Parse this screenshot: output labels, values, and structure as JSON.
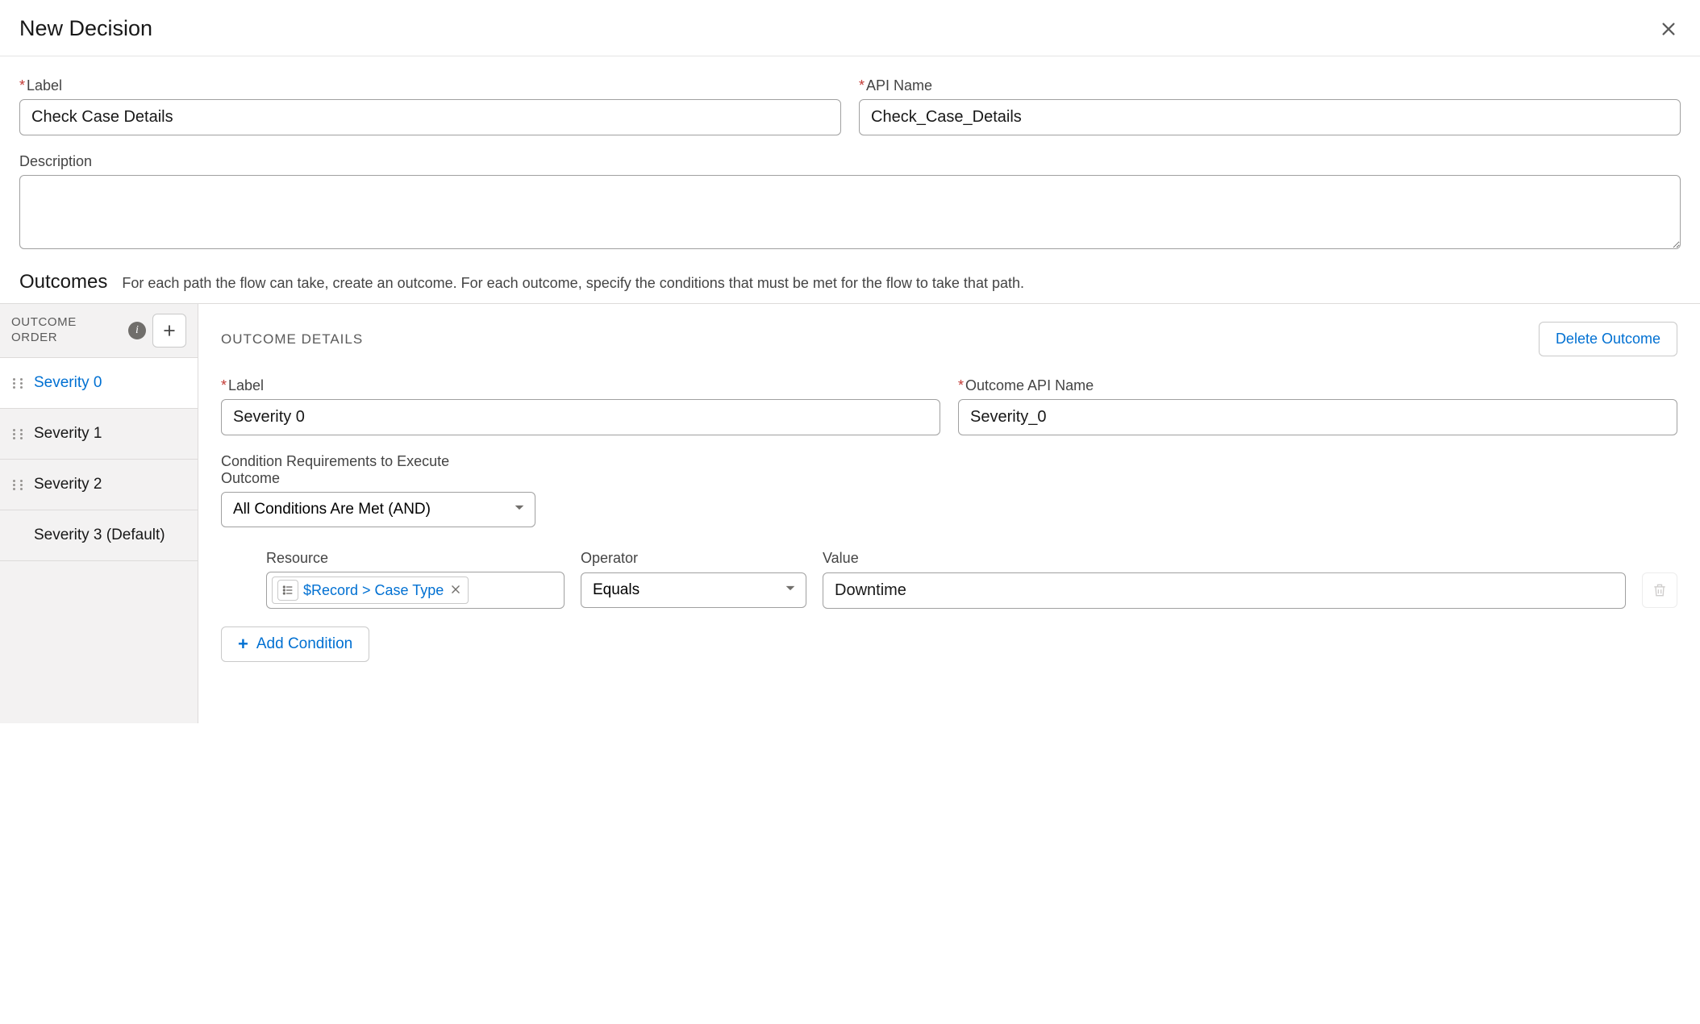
{
  "header": {
    "title": "New Decision"
  },
  "form": {
    "label_field_label": "Label",
    "label_value": "Check Case Details",
    "api_name_label": "API Name",
    "api_name_value": "Check_Case_Details",
    "description_label": "Description",
    "description_value": ""
  },
  "outcomes": {
    "title": "Outcomes",
    "help": "For each path the flow can take, create an outcome. For each outcome, specify the conditions that must be met for the flow to take that path."
  },
  "sidebar": {
    "header": "OUTCOME ORDER",
    "items": [
      {
        "label": "Severity 0",
        "active": true,
        "draggable": true
      },
      {
        "label": "Severity 1",
        "active": false,
        "draggable": true
      },
      {
        "label": "Severity 2",
        "active": false,
        "draggable": true
      },
      {
        "label": "Severity 3 (Default)",
        "active": false,
        "draggable": false
      }
    ]
  },
  "details": {
    "title": "OUTCOME DETAILS",
    "delete_label": "Delete Outcome",
    "label_field_label": "Label",
    "label_value": "Severity 0",
    "api_name_label": "Outcome API Name",
    "api_name_value": "Severity_0",
    "cond_req_label": "Condition Requirements to Execute Outcome",
    "cond_req_value": "All Conditions Are Met (AND)",
    "columns": {
      "resource": "Resource",
      "operator": "Operator",
      "value": "Value"
    },
    "condition": {
      "resource_pill": "$Record > Case Type",
      "operator": "Equals",
      "value": "Downtime"
    },
    "add_condition_label": "Add Condition"
  }
}
